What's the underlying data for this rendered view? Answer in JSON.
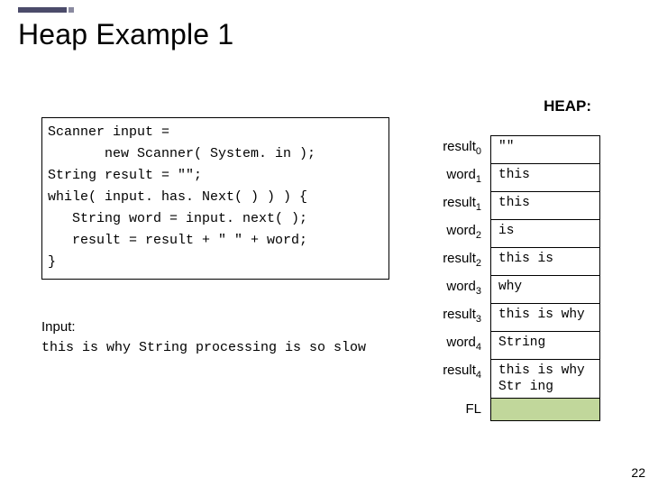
{
  "title": "Heap Example 1",
  "code": "Scanner input =\n       new Scanner( System. in );\nString result = \"\";\nwhile( input. has. Next( ) ) ) {\n   String word = input. next( );\n   result = result + \" \" + word;\n}",
  "input_label": "Input:",
  "input_text": "this is why String processing is so slow",
  "heap_label": "HEAP:",
  "heap_rows": [
    {
      "key": "result",
      "sub": "0",
      "val": "\"\""
    },
    {
      "key": "word",
      "sub": "1",
      "val": "this"
    },
    {
      "key": "result",
      "sub": "1",
      "val": "this"
    },
    {
      "key": "word",
      "sub": "2",
      "val": "is"
    },
    {
      "key": "result",
      "sub": "2",
      "val": "this is"
    },
    {
      "key": "word",
      "sub": "3",
      "val": "why"
    },
    {
      "key": "result",
      "sub": "3",
      "val": "this is why"
    },
    {
      "key": "word",
      "sub": "4",
      "val": "String"
    },
    {
      "key": "result",
      "sub": "4",
      "val": "this is why Str ing"
    }
  ],
  "heap_fl_label": "FL",
  "page_number": "22"
}
